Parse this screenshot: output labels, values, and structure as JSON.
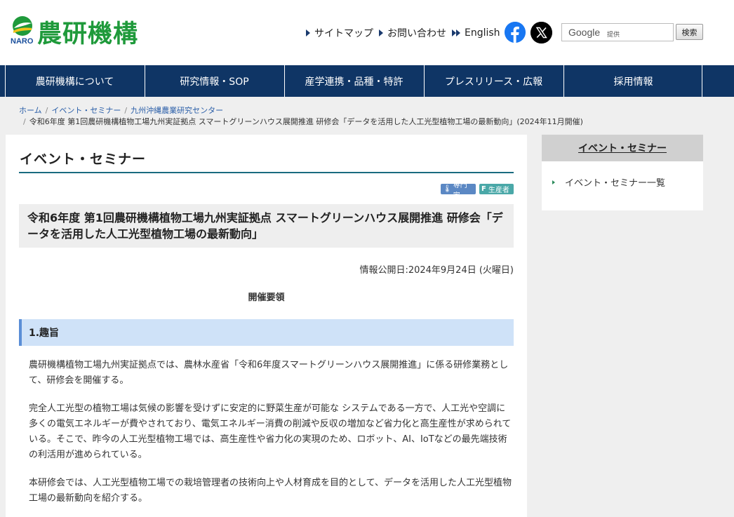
{
  "header": {
    "logo_text": "農研機構",
    "logo_sub": "NARO",
    "links": [
      {
        "label": "サイトマップ",
        "icon": "triangle-right-icon"
      },
      {
        "label": "お問い合わせ",
        "icon": "triangle-right-icon"
      },
      {
        "label": "English",
        "icon": "double-triangle-right-icon"
      }
    ],
    "search": {
      "brand": "Google",
      "powered": "提供",
      "value": "",
      "button_label": "検索"
    }
  },
  "nav": {
    "items": [
      {
        "label": "農研機構について"
      },
      {
        "label": "研究情報・SOP"
      },
      {
        "label": "産学連携・品種・特許"
      },
      {
        "label": "プレスリリース・広報"
      },
      {
        "label": "採用情報"
      }
    ]
  },
  "breadcrumb": {
    "items": [
      "ホーム",
      "イベント・セミナー",
      "九州沖縄農業研究センター"
    ],
    "current": "令和6年度 第1回農研機構植物工場九州実証拠点 スマートグリーンハウス展開推進 研修会「データを活用した人工光型植物工場の最新動向」(2024年11月開催)"
  },
  "main": {
    "heading": "イベント・セミナー",
    "tags": [
      "専門家",
      "生産者"
    ],
    "title": "令和6年度 第1回農研機構植物工場九州実証拠点 スマートグリーンハウス展開推進 研修会「データを活用した人工光型植物工場の最新動向」",
    "date": "情報公開日:2024年9月24日 (火曜日)",
    "subheading": "開催要領",
    "section_title": "1.趣旨",
    "paragraphs": [
      "農研機構植物工場九州実証拠点では、農林水産省「令和6年度スマートグリーンハウス展開推進」に係る研修業務として、研修会を開催する。",
      "完全人工光型の植物工場は気候の影響を受けずに安定的に野菜生産が可能な システムである一方で、人工光や空調に多くの電気エネルギーが費やされており、電気エネルギー消費の削減や反収の増加など省力化と高生産性が求められている。そこで、昨今の人工光型植物工場では、高生産性や省力化の実現のため、ロボット、AI、IoTなどの最先端技術の利活用が進められている。",
      "本研修会では、人工光型植物工場での栽培管理者の技術向上や人材育成を目的として、データを活用した人工光型植物工場の最新動向を紹介する。"
    ]
  },
  "sidebar": {
    "heading": "イベント・セミナー",
    "items": [
      {
        "label": "イベント・セミナー一覧"
      }
    ]
  },
  "colors": {
    "brand_green": "#1f9a3b",
    "nav_bg": "#0f3565",
    "section_bg": "#cfe2f8"
  }
}
